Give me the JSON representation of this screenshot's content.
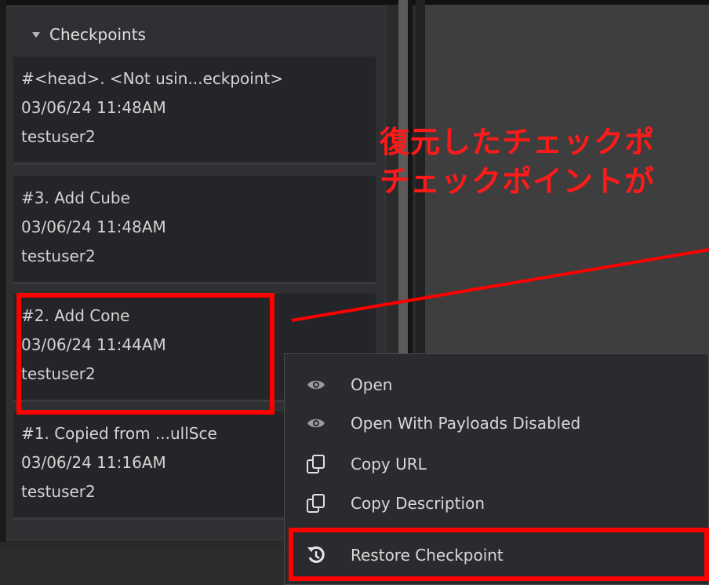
{
  "panel": {
    "title": "Checkpoints",
    "items": [
      {
        "title": "#<head>.   <Not usin...eckpoint>",
        "date": "03/06/24 11:48AM",
        "user": "testuser2"
      },
      {
        "title": "#3.   Add Cube",
        "date": "03/06/24 11:48AM",
        "user": "testuser2"
      },
      {
        "title": "#2.   Add Cone",
        "date": "03/06/24 11:44AM",
        "user": "testuser2"
      },
      {
        "title": "#1.   Copied from ...ullSce",
        "date": "03/06/24 11:16AM",
        "user": "testuser2"
      }
    ]
  },
  "annotation": {
    "line1": "復元したチェックポ",
    "line2": "チェックポイントが"
  },
  "context_menu": {
    "items": [
      {
        "label": "Open",
        "icon": "eye-icon"
      },
      {
        "label": "Open With Payloads Disabled",
        "icon": "eye-icon"
      },
      {
        "label": "Copy URL",
        "icon": "copy-icon"
      },
      {
        "label": "Copy Description",
        "icon": "copy-icon"
      },
      {
        "label": "Restore Checkpoint",
        "icon": "restore-icon"
      }
    ]
  },
  "colors": {
    "highlight": "#ff0000",
    "annotation_text": "#ff1a1a"
  }
}
